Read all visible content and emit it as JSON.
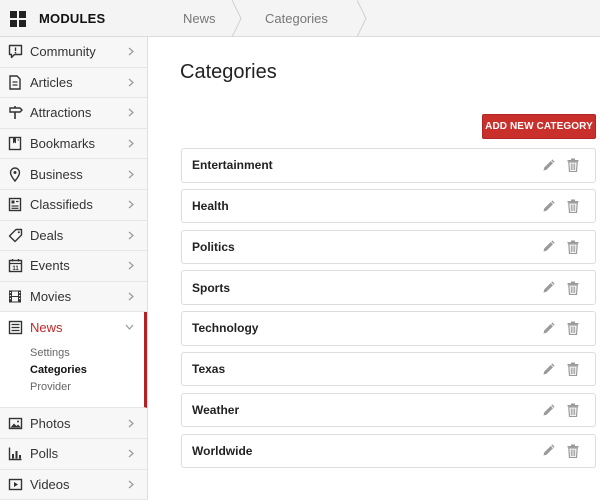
{
  "header": {
    "modules_label": "MODULES",
    "breadcrumbs": [
      {
        "label": "News"
      },
      {
        "label": "Categories"
      }
    ]
  },
  "sidebar": {
    "items": [
      {
        "label": "Community",
        "icon": "speech-bubble-icon"
      },
      {
        "label": "Articles",
        "icon": "document-icon"
      },
      {
        "label": "Attractions",
        "icon": "signpost-icon"
      },
      {
        "label": "Bookmarks",
        "icon": "bookmark-icon"
      },
      {
        "label": "Business",
        "icon": "map-pin-icon"
      },
      {
        "label": "Classifieds",
        "icon": "classifieds-icon"
      },
      {
        "label": "Deals",
        "icon": "tag-icon"
      },
      {
        "label": "Events",
        "icon": "calendar-icon"
      },
      {
        "label": "Movies",
        "icon": "film-icon"
      },
      {
        "label": "News",
        "icon": "newspaper-icon",
        "active": true
      },
      {
        "label": "Photos",
        "icon": "image-icon"
      },
      {
        "label": "Polls",
        "icon": "bar-chart-icon"
      },
      {
        "label": "Videos",
        "icon": "video-icon"
      }
    ],
    "news_sub": [
      {
        "label": "Settings"
      },
      {
        "label": "Categories",
        "current": true
      },
      {
        "label": "Provider"
      }
    ],
    "calendar_number": "11"
  },
  "main": {
    "title": "Categories",
    "add_button": "ADD NEW CATEGORY",
    "categories": [
      {
        "name": "Entertainment"
      },
      {
        "name": "Health"
      },
      {
        "name": "Politics"
      },
      {
        "name": "Sports"
      },
      {
        "name": "Technology"
      },
      {
        "name": "Texas"
      },
      {
        "name": "Weather"
      },
      {
        "name": "Worldwide"
      }
    ]
  },
  "colors": {
    "accent": "#c9302c",
    "active_text": "#c0282d"
  }
}
